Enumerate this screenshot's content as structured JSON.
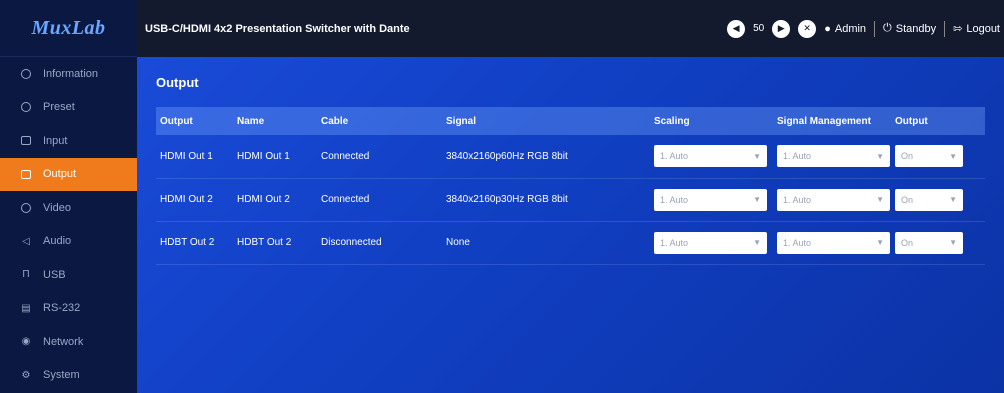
{
  "sidebar": {
    "logo": "MuxLab",
    "items": [
      {
        "label": "Information",
        "icon": "info-icon"
      },
      {
        "label": "Preset",
        "icon": "preset-icon"
      },
      {
        "label": "Input",
        "icon": "input-icon"
      },
      {
        "label": "Output",
        "icon": "output-icon",
        "active": true
      },
      {
        "label": "Video",
        "icon": "video-icon"
      },
      {
        "label": "Audio",
        "icon": "audio-icon"
      },
      {
        "label": "USB",
        "icon": "usb-icon"
      },
      {
        "label": "RS-232",
        "icon": "rs232-icon"
      },
      {
        "label": "Network",
        "icon": "network-icon"
      },
      {
        "label": "System",
        "icon": "system-icon"
      }
    ]
  },
  "header": {
    "title": "USB-C/HDMI 4x2 Presentation Switcher with Dante",
    "volume": "50",
    "user": "Admin",
    "standby": "Standby",
    "logout": "Logout"
  },
  "main": {
    "section_title": "Output",
    "columns": [
      "Output",
      "Name",
      "Cable",
      "Signal",
      "Scaling",
      "Signal Management",
      "Output"
    ],
    "rows": [
      {
        "output": "HDMI Out 1",
        "name": "HDMI Out 1",
        "cable": "Connected",
        "signal": "3840x2160p60Hz RGB 8bit",
        "scaling": "1. Auto",
        "signal_management": "1. Auto",
        "out": "On"
      },
      {
        "output": "HDMI Out 2",
        "name": "HDMI Out 2",
        "cable": "Connected",
        "signal": "3840x2160p30Hz RGB 8bit",
        "scaling": "1. Auto",
        "signal_management": "1. Auto",
        "out": "On"
      },
      {
        "output": "HDBT Out 2",
        "name": "HDBT Out 2",
        "cable": "Disconnected",
        "signal": "None",
        "scaling": "1. Auto",
        "signal_management": "1. Auto",
        "out": "On"
      }
    ]
  },
  "colors": {
    "accent": "#f07b1c",
    "sidebar": "#0a1842",
    "topbar": "#131a2e",
    "main": "#1a4bd8"
  }
}
